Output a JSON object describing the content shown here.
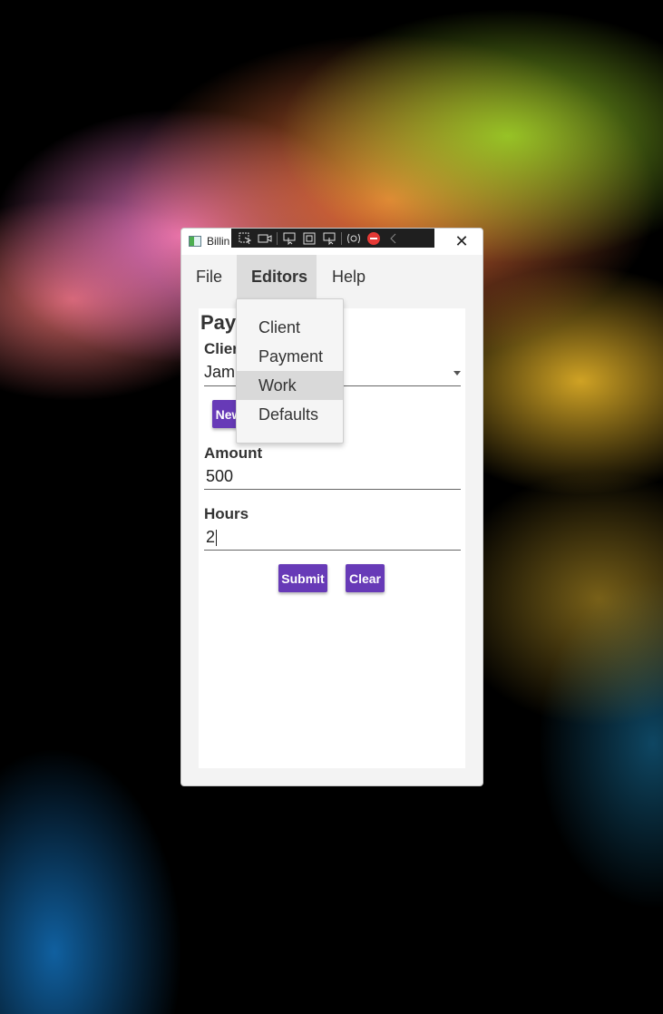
{
  "window": {
    "title": "Billin",
    "close_glyph": "✕"
  },
  "debug_toolbar": {
    "icons": [
      "select-element-icon",
      "record-icon",
      "pointer-icon",
      "layout-icon",
      "display-icon",
      "hot-reload-icon",
      "stop-icon",
      "collapse-icon"
    ]
  },
  "menubar": {
    "items": [
      {
        "label": "File"
      },
      {
        "label": "Editors"
      },
      {
        "label": "Help"
      }
    ]
  },
  "editors_menu": {
    "items": [
      {
        "label": "Client"
      },
      {
        "label": "Payment"
      },
      {
        "label": "Work"
      },
      {
        "label": "Defaults"
      }
    ],
    "hovered": "Work"
  },
  "form": {
    "title_visible": "Pay",
    "client_label_visible": "Clier",
    "client_value_visible": "Jam",
    "new_button_visible": "New",
    "amount_label": "Amount",
    "amount_value": "500",
    "hours_label": "Hours",
    "hours_value": "2",
    "submit_label": "Submit",
    "clear_label": "Clear"
  },
  "colors": {
    "accent": "#673ab7",
    "menu_active_bg": "#dcdcdc",
    "popup_hover_bg": "#d9d9d9"
  }
}
